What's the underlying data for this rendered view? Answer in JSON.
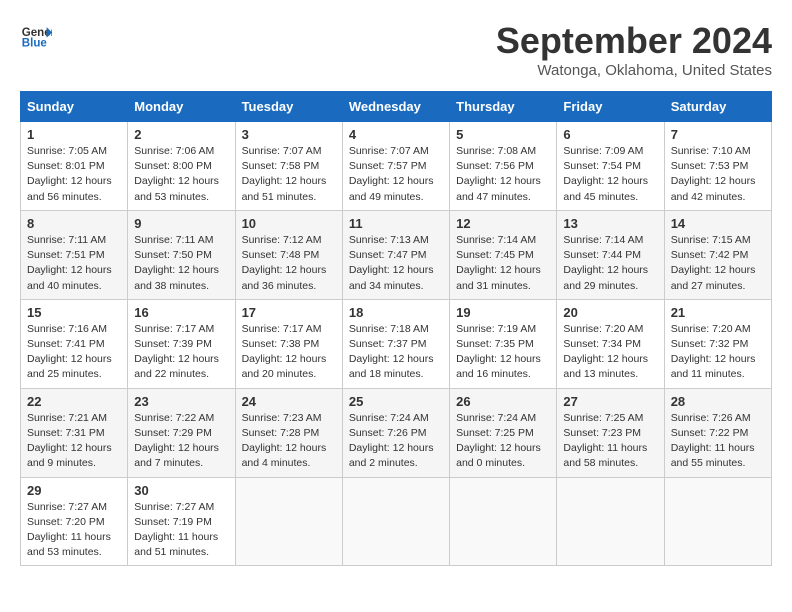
{
  "header": {
    "logo_line1": "General",
    "logo_line2": "Blue",
    "month": "September 2024",
    "location": "Watonga, Oklahoma, United States"
  },
  "weekdays": [
    "Sunday",
    "Monday",
    "Tuesday",
    "Wednesday",
    "Thursday",
    "Friday",
    "Saturday"
  ],
  "weeks": [
    [
      {
        "day": "1",
        "sunrise": "Sunrise: 7:05 AM",
        "sunset": "Sunset: 8:01 PM",
        "daylight": "Daylight: 12 hours and 56 minutes."
      },
      {
        "day": "2",
        "sunrise": "Sunrise: 7:06 AM",
        "sunset": "Sunset: 8:00 PM",
        "daylight": "Daylight: 12 hours and 53 minutes."
      },
      {
        "day": "3",
        "sunrise": "Sunrise: 7:07 AM",
        "sunset": "Sunset: 7:58 PM",
        "daylight": "Daylight: 12 hours and 51 minutes."
      },
      {
        "day": "4",
        "sunrise": "Sunrise: 7:07 AM",
        "sunset": "Sunset: 7:57 PM",
        "daylight": "Daylight: 12 hours and 49 minutes."
      },
      {
        "day": "5",
        "sunrise": "Sunrise: 7:08 AM",
        "sunset": "Sunset: 7:56 PM",
        "daylight": "Daylight: 12 hours and 47 minutes."
      },
      {
        "day": "6",
        "sunrise": "Sunrise: 7:09 AM",
        "sunset": "Sunset: 7:54 PM",
        "daylight": "Daylight: 12 hours and 45 minutes."
      },
      {
        "day": "7",
        "sunrise": "Sunrise: 7:10 AM",
        "sunset": "Sunset: 7:53 PM",
        "daylight": "Daylight: 12 hours and 42 minutes."
      }
    ],
    [
      {
        "day": "8",
        "sunrise": "Sunrise: 7:11 AM",
        "sunset": "Sunset: 7:51 PM",
        "daylight": "Daylight: 12 hours and 40 minutes."
      },
      {
        "day": "9",
        "sunrise": "Sunrise: 7:11 AM",
        "sunset": "Sunset: 7:50 PM",
        "daylight": "Daylight: 12 hours and 38 minutes."
      },
      {
        "day": "10",
        "sunrise": "Sunrise: 7:12 AM",
        "sunset": "Sunset: 7:48 PM",
        "daylight": "Daylight: 12 hours and 36 minutes."
      },
      {
        "day": "11",
        "sunrise": "Sunrise: 7:13 AM",
        "sunset": "Sunset: 7:47 PM",
        "daylight": "Daylight: 12 hours and 34 minutes."
      },
      {
        "day": "12",
        "sunrise": "Sunrise: 7:14 AM",
        "sunset": "Sunset: 7:45 PM",
        "daylight": "Daylight: 12 hours and 31 minutes."
      },
      {
        "day": "13",
        "sunrise": "Sunrise: 7:14 AM",
        "sunset": "Sunset: 7:44 PM",
        "daylight": "Daylight: 12 hours and 29 minutes."
      },
      {
        "day": "14",
        "sunrise": "Sunrise: 7:15 AM",
        "sunset": "Sunset: 7:42 PM",
        "daylight": "Daylight: 12 hours and 27 minutes."
      }
    ],
    [
      {
        "day": "15",
        "sunrise": "Sunrise: 7:16 AM",
        "sunset": "Sunset: 7:41 PM",
        "daylight": "Daylight: 12 hours and 25 minutes."
      },
      {
        "day": "16",
        "sunrise": "Sunrise: 7:17 AM",
        "sunset": "Sunset: 7:39 PM",
        "daylight": "Daylight: 12 hours and 22 minutes."
      },
      {
        "day": "17",
        "sunrise": "Sunrise: 7:17 AM",
        "sunset": "Sunset: 7:38 PM",
        "daylight": "Daylight: 12 hours and 20 minutes."
      },
      {
        "day": "18",
        "sunrise": "Sunrise: 7:18 AM",
        "sunset": "Sunset: 7:37 PM",
        "daylight": "Daylight: 12 hours and 18 minutes."
      },
      {
        "day": "19",
        "sunrise": "Sunrise: 7:19 AM",
        "sunset": "Sunset: 7:35 PM",
        "daylight": "Daylight: 12 hours and 16 minutes."
      },
      {
        "day": "20",
        "sunrise": "Sunrise: 7:20 AM",
        "sunset": "Sunset: 7:34 PM",
        "daylight": "Daylight: 12 hours and 13 minutes."
      },
      {
        "day": "21",
        "sunrise": "Sunrise: 7:20 AM",
        "sunset": "Sunset: 7:32 PM",
        "daylight": "Daylight: 12 hours and 11 minutes."
      }
    ],
    [
      {
        "day": "22",
        "sunrise": "Sunrise: 7:21 AM",
        "sunset": "Sunset: 7:31 PM",
        "daylight": "Daylight: 12 hours and 9 minutes."
      },
      {
        "day": "23",
        "sunrise": "Sunrise: 7:22 AM",
        "sunset": "Sunset: 7:29 PM",
        "daylight": "Daylight: 12 hours and 7 minutes."
      },
      {
        "day": "24",
        "sunrise": "Sunrise: 7:23 AM",
        "sunset": "Sunset: 7:28 PM",
        "daylight": "Daylight: 12 hours and 4 minutes."
      },
      {
        "day": "25",
        "sunrise": "Sunrise: 7:24 AM",
        "sunset": "Sunset: 7:26 PM",
        "daylight": "Daylight: 12 hours and 2 minutes."
      },
      {
        "day": "26",
        "sunrise": "Sunrise: 7:24 AM",
        "sunset": "Sunset: 7:25 PM",
        "daylight": "Daylight: 12 hours and 0 minutes."
      },
      {
        "day": "27",
        "sunrise": "Sunrise: 7:25 AM",
        "sunset": "Sunset: 7:23 PM",
        "daylight": "Daylight: 11 hours and 58 minutes."
      },
      {
        "day": "28",
        "sunrise": "Sunrise: 7:26 AM",
        "sunset": "Sunset: 7:22 PM",
        "daylight": "Daylight: 11 hours and 55 minutes."
      }
    ],
    [
      {
        "day": "29",
        "sunrise": "Sunrise: 7:27 AM",
        "sunset": "Sunset: 7:20 PM",
        "daylight": "Daylight: 11 hours and 53 minutes."
      },
      {
        "day": "30",
        "sunrise": "Sunrise: 7:27 AM",
        "sunset": "Sunset: 7:19 PM",
        "daylight": "Daylight: 11 hours and 51 minutes."
      },
      null,
      null,
      null,
      null,
      null
    ]
  ]
}
